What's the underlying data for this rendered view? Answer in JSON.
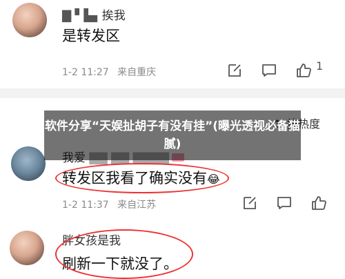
{
  "comments": [
    {
      "username": "挨我",
      "text": "是转发区",
      "timestamp": "1-2 11:27",
      "location": "来自重庆",
      "likes": "1"
    },
    {
      "username": "我爱",
      "text": "转发区我看了确实没有",
      "timestamp": "1-2 11:37",
      "location": "来自江苏",
      "likes": ""
    },
    {
      "username": "胖女孩是我",
      "text": "刷新一下就没了。",
      "timestamp": "",
      "location": "",
      "likes": ""
    }
  ],
  "sort_label": "按热度",
  "overlay_title": "软件分享“天娱扯胡子有没有挂”(曝光透视必备猫腻)",
  "colors": {
    "overlay": "rgba(0,0,0,0.55)",
    "annotation": "#e33333",
    "meta": "#8a8a8a"
  },
  "icons": [
    "share-icon",
    "comment-icon",
    "like-icon"
  ]
}
